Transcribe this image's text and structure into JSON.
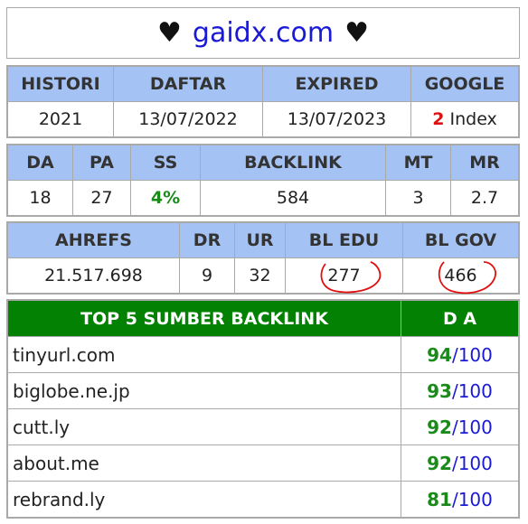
{
  "title": {
    "left_glyph": "♥",
    "site": "gaidx.com",
    "right_glyph": "♥"
  },
  "table1": {
    "headers": [
      "HISTORI",
      "DAFTAR",
      "EXPIRED",
      "GOOGLE"
    ],
    "values": {
      "histori": "2021",
      "daftar": "13/07/2022",
      "expired": "13/07/2023",
      "google_count": "2",
      "google_label": "Index"
    }
  },
  "table2": {
    "headers": [
      "DA",
      "PA",
      "SS",
      "BACKLINK",
      "MT",
      "MR"
    ],
    "values": {
      "da": "18",
      "pa": "27",
      "ss": "4%",
      "backlink": "584",
      "mt": "3",
      "mr": "2.7"
    }
  },
  "table3": {
    "headers": [
      "AHREFS",
      "DR",
      "UR",
      "BL EDU",
      "BL GOV"
    ],
    "values": {
      "ahrefs": "21.517.698",
      "dr": "9",
      "ur": "32",
      "bl_edu": "277",
      "bl_gov": "466"
    }
  },
  "table4": {
    "headers": [
      "TOP 5 SUMBER BACKLINK",
      "D A"
    ],
    "rows": [
      {
        "site": "tinyurl.com",
        "score": "94",
        "max": "/100"
      },
      {
        "site": "biglobe.ne.jp",
        "score": "93",
        "max": "/100"
      },
      {
        "site": "cutt.ly",
        "score": "92",
        "max": "/100"
      },
      {
        "site": "about.me",
        "score": "92",
        "max": "/100"
      },
      {
        "site": "rebrand.ly",
        "score": "81",
        "max": "/100"
      }
    ]
  },
  "colors": {
    "header_blue": "#a4c2f4",
    "header_green": "#028102",
    "link_blue": "#1a1ad6",
    "score_green": "#1a8a1a",
    "mark_red": "#e01010"
  }
}
